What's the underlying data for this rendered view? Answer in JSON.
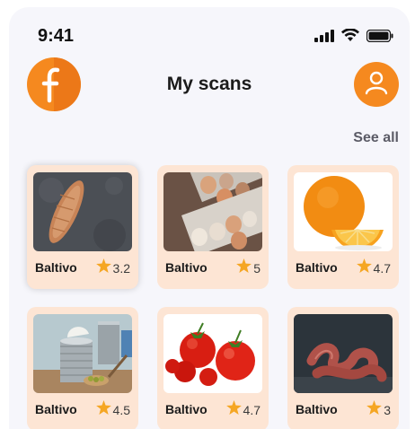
{
  "status_bar": {
    "time": "9:41",
    "icons": [
      "signal-icon",
      "wifi-icon",
      "battery-icon"
    ]
  },
  "header": {
    "title": "My scans",
    "logo_icon": "app-logo-f",
    "profile_icon": "user-icon"
  },
  "see_all_label": "See all",
  "colors": {
    "accent": "#f5891f",
    "card_bg": "#fde5d4",
    "star": "#f5a623",
    "background": "#f6f6fb"
  },
  "scans": [
    {
      "brand": "Baltivo",
      "rating": "3.2",
      "image": "bread-on-stone"
    },
    {
      "brand": "Baltivo",
      "rating": "5",
      "image": "eggs-in-carton"
    },
    {
      "brand": "Baltivo",
      "rating": "4.7",
      "image": "orange"
    },
    {
      "brand": "Baltivo",
      "rating": "4.5",
      "image": "cans-with-olives"
    },
    {
      "brand": "Baltivo",
      "rating": "4.7",
      "image": "tomatoes"
    },
    {
      "brand": "Baltivo",
      "rating": "3",
      "image": "sausages"
    }
  ]
}
